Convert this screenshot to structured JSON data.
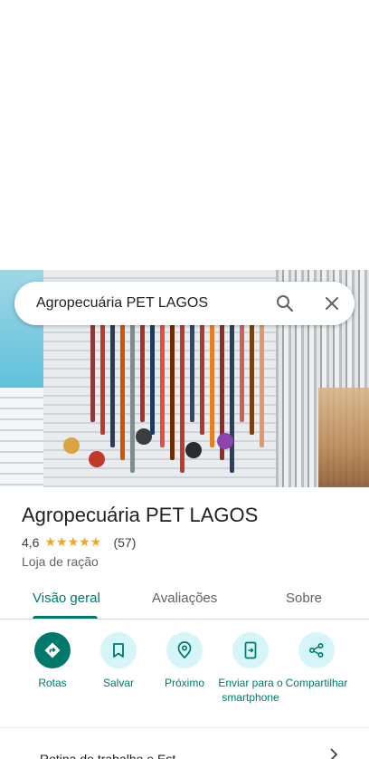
{
  "search": {
    "query": "Agropecuária PET LAGOS"
  },
  "place": {
    "name": "Agropecuária PET LAGOS",
    "rating": "4,6",
    "rating_fraction": 0.92,
    "review_count": "(57)",
    "category": "Loja de ração"
  },
  "tabs": [
    {
      "label": "Visão geral",
      "active": true
    },
    {
      "label": "Avaliações",
      "active": false
    },
    {
      "label": "Sobre",
      "active": false
    }
  ],
  "actions": [
    {
      "label": "Rotas",
      "icon": "directions-icon",
      "primary": true
    },
    {
      "label": "Salvar",
      "icon": "bookmark-icon",
      "primary": false
    },
    {
      "label": "Próximo",
      "icon": "nearby-icon",
      "primary": false
    },
    {
      "label": "Enviar para o smartphone",
      "icon": "send-to-phone-icon",
      "primary": false
    },
    {
      "label": "Compartilhar",
      "icon": "share-icon",
      "primary": false
    }
  ],
  "bottom_row": {
    "label": "Rotina de trabalho e Est..."
  },
  "colors": {
    "accent": "#00796b",
    "action_bg": "#d6f5f9",
    "star": "#f5a623"
  }
}
